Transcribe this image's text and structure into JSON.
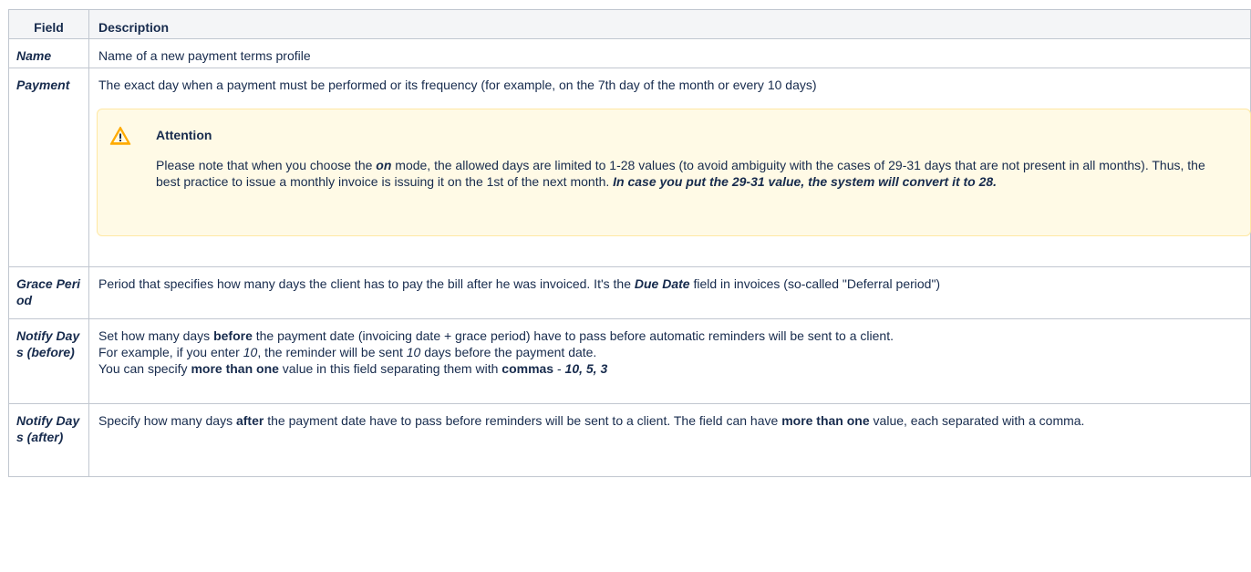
{
  "headers": {
    "field": "Field",
    "description": "Description"
  },
  "rows": {
    "name": {
      "field": "Name",
      "description": "Name of a new payment terms profile"
    },
    "payment": {
      "field": "Payment",
      "description": "The exact day when a payment must be performed or its frequency (for example, on the 7th day of the month or every 10 days)",
      "attention": {
        "title": "Attention",
        "t1": "Please note that when you choose the ",
        "mode": "on",
        "t2": " mode, the allowed days are limited to 1-28 values (to avoid ambiguity with the cases of 29-31 days that are not present in all months). Thus, the best practice to issue a monthly invoice is issuing it on the 1st of the next month. ",
        "emphasis": "In case you put the 29-31 value, the system will convert it to 28."
      }
    },
    "grace": {
      "field": "Grace Period",
      "t1": "Period that specifies how many days the client has to pay the bill after he was invoiced. It's the ",
      "due": "Due Date",
      "t2": " field in invoices (so-called \"Deferral period\")"
    },
    "before": {
      "field": "Notify Days (before)",
      "t1": "Set how many days ",
      "before": "before",
      "t2": " the payment date (invoicing date + grace period) have to pass before automatic reminders will be sent to a client.",
      "t3": "For example, if you enter ",
      "v1": "10",
      "t4": ", the reminder will be sent ",
      "v2": "10",
      "t5": " days before the payment date.",
      "t6": "You can specify ",
      "more": "more than one",
      "t7": " value in this field separating them with ",
      "commas": "commas",
      "t8": " - ",
      "values": "10, 5, 3"
    },
    "after": {
      "field": "Notify Days (after)",
      "t1": "Specify how many days ",
      "after": "after",
      "t2": " the payment date have to pass before reminders will be sent to a client. The field can have ",
      "more": "more than one",
      "t3": " value, each separated with a comma."
    }
  },
  "icons": {
    "attention": "warning-icon"
  },
  "colors": {
    "panel_bg": "#fffae6",
    "panel_border": "#ffe8a3",
    "header_bg": "#f4f5f7",
    "border": "#c1c7d0"
  }
}
